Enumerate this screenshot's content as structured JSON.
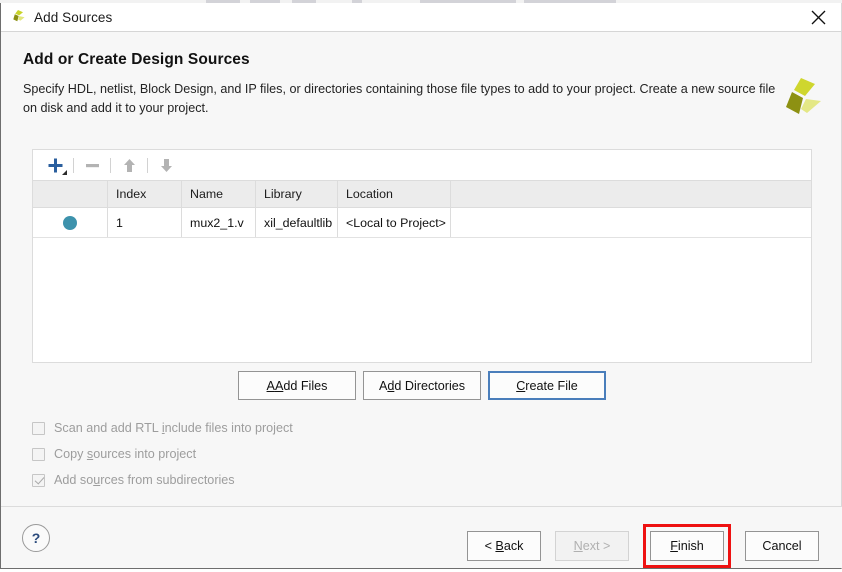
{
  "window": {
    "title": "Add Sources",
    "icon": "xilinx-logo-icon",
    "close_label": "close-icon"
  },
  "header": {
    "heading": "Add or Create Design Sources",
    "description": "Specify HDL, netlist, Block Design, and IP files, or directories containing those file types to add to your project. Create a new source file on disk and add it to your project.",
    "brand_logo": "xilinx-pinwheel-logo"
  },
  "panel": {
    "toolbar": [
      {
        "name": "add-icon",
        "glyph": "+",
        "color": "#2b5f9e",
        "enabled": true,
        "has_dropdown": true
      },
      {
        "name": "remove-icon",
        "glyph": "−",
        "color": "#b3b3b3",
        "enabled": false,
        "has_dropdown": false
      },
      {
        "name": "move-up-icon",
        "glyph": "↑",
        "color": "#b3b3b3",
        "enabled": false,
        "has_dropdown": false
      },
      {
        "name": "move-down-icon",
        "glyph": "↓",
        "color": "#b3b3b3",
        "enabled": false,
        "has_dropdown": false
      }
    ],
    "columns": [
      "",
      "Index",
      "Name",
      "Library",
      "Location",
      ""
    ],
    "rows": [
      {
        "marker": "●",
        "marker_color": "#3d92ac",
        "index": "1",
        "name": "mux2_1.v",
        "library": "xil_defaultlib",
        "location": "<Local to Project>"
      }
    ]
  },
  "actions": {
    "add_files": "Add Files",
    "add_directories": "Add Directories",
    "create_file": "Create File",
    "focused": "Create File"
  },
  "options": [
    {
      "label": "Scan and add RTL include files into project",
      "checked": false,
      "enabled": false
    },
    {
      "label": "Copy sources into project",
      "checked": false,
      "enabled": false
    },
    {
      "label": "Add sources from subdirectories",
      "checked": true,
      "enabled": false
    }
  ],
  "footer": {
    "help": "?",
    "back": "< Back",
    "next": "Next >",
    "finish": "Finish",
    "cancel": "Cancel",
    "next_enabled": false,
    "highlight": {
      "target": "Finish",
      "color": "#ee1111"
    }
  }
}
